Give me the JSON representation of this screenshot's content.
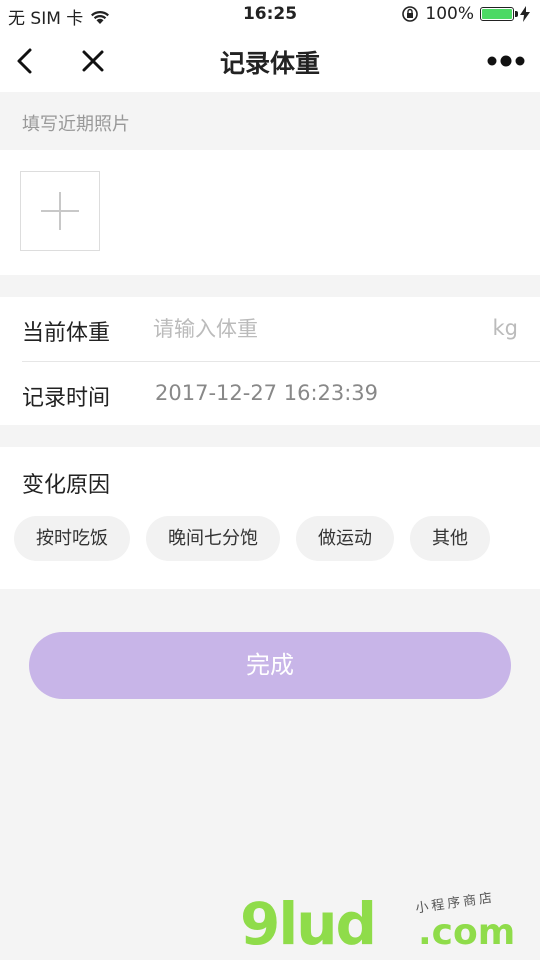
{
  "status_bar": {
    "carrier": "无 SIM 卡",
    "time": "16:25",
    "battery": "100%"
  },
  "nav": {
    "title": "记录体重"
  },
  "photo_section": {
    "label": "填写近期照片"
  },
  "form": {
    "weight_label": "当前体重",
    "weight_placeholder": "请输入体重",
    "weight_unit": "kg",
    "time_label": "记录时间",
    "time_value": "2017-12-27 16:23:39"
  },
  "reasons": {
    "heading": "变化原因",
    "chips": [
      "按时吃饭",
      "晚间七分饱",
      "做运动",
      "其他"
    ]
  },
  "done_button": {
    "label": "完成",
    "color": "#c8b5e8"
  },
  "watermark": {
    "logo": "9lud",
    "domain": ".com",
    "subtitle": "小程序商店"
  }
}
